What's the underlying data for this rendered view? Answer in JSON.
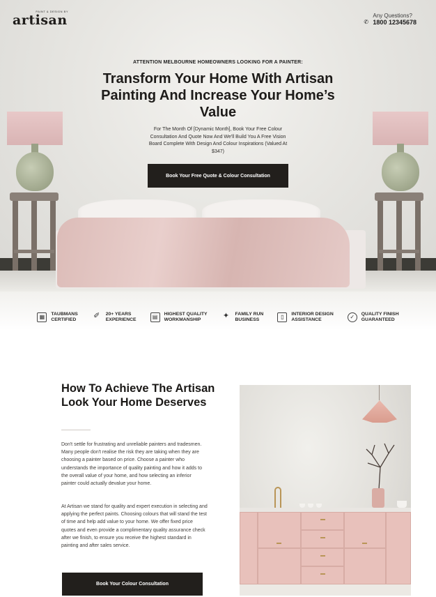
{
  "header": {
    "brand_tagline": "PAINT & DESIGN BY",
    "brand_name": "artisan",
    "contact_label": "Any Questions?",
    "contact_phone": "1800 12345678"
  },
  "hero": {
    "eyebrow": "ATTENTION MELBOURNE HOMEOWNERS LOOKING FOR A PAINTER:",
    "headline": "Transform Your Home With Artisan Painting And Increase Your Home’s Value",
    "subcopy": "For The Month Of [Dynamic Month], Book Your Free Colour Consultation And Quote Now And We'll Build You A Free Vision Board Complete With Design And Colour Inspirations (Valued At $347)",
    "cta_label": "Book Your Free Quote & Colour Consultation"
  },
  "features": [
    {
      "label": "TAUBMANS\nCERTIFIED",
      "icon": "certificate-icon"
    },
    {
      "label": "20+ YEARS\nEXPERIENCE",
      "icon": "paintbrush-icon"
    },
    {
      "label": "HIGHEST QUALITY\nWORKMANSHIP",
      "icon": "paint-roller-icon"
    },
    {
      "label": "FAMILY RUN\nBUSINESS",
      "icon": "family-icon"
    },
    {
      "label": "INTERIOR DESIGN\nASSISTANCE",
      "icon": "design-icon"
    },
    {
      "label": "QUALITY FINISH\nGUARANTEED",
      "icon": "badge-icon"
    }
  ],
  "section2": {
    "heading": "How To Achieve The Artisan Look Your Home Deserves",
    "paragraph1": "Don't settle for frustrating and unreliable painters and tradesmen.  Many people don't realise the risk they are taking when they are choosing a painter based on price. Choose a painter who understands the importance of quality painting and how it adds to the overall value of your home, and how selecting an inferior painter could actually devalue your home.",
    "paragraph2": "At Artisan we stand for quality and expert execution in selecting and applying the perfect paints. Choosing colours that will stand the test of time and help add value to your home.  We offer fixed price quotes and even provide a complimentary quality assurance check after we finish, to ensure you receive the highest standard in painting and after sales service.",
    "cta_label": "Book Your Colour Consultation"
  },
  "colors": {
    "dark_button": "#221f1c",
    "accent_pink": "#e8c1bb"
  }
}
